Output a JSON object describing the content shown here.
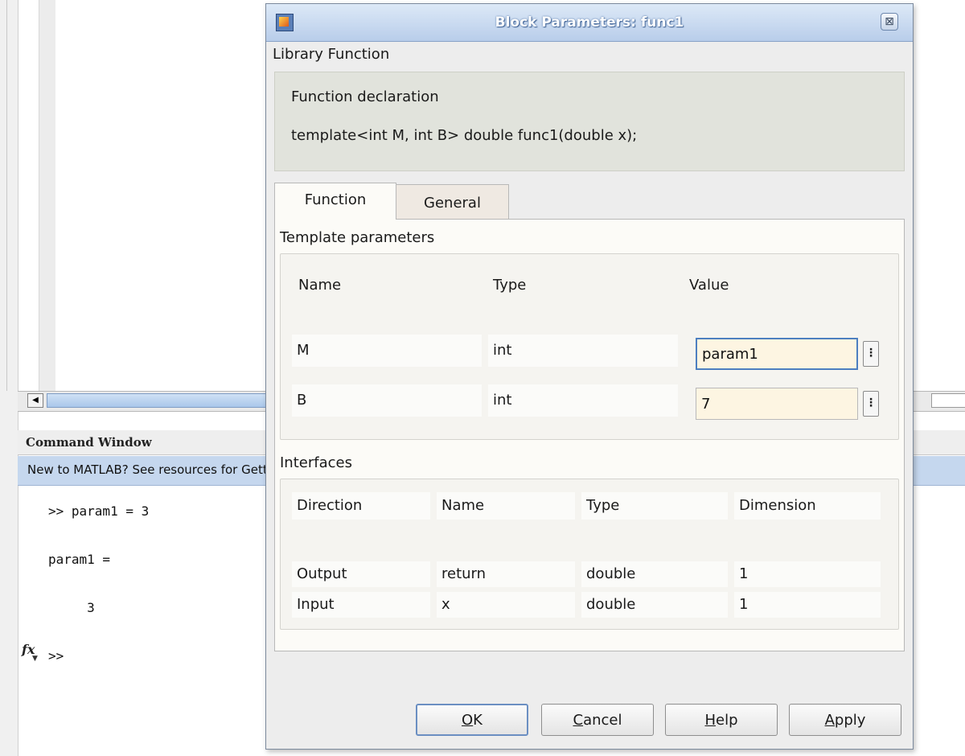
{
  "matlab": {
    "command_window_title": "Command Window",
    "info_bar_text": "New to MATLAB? See resources for Getting Started.",
    "command_lines": [
      ">> param1 = 3",
      "param1 =",
      "     3",
      ">>"
    ],
    "fx_label": "fx"
  },
  "dialog": {
    "title": "Block Parameters: func1",
    "close_glyph": "⊠",
    "library_label": "Library Function",
    "declaration": {
      "title": "Function declaration",
      "text": "template<int M, int B> double func1(double x);"
    },
    "tabs": [
      {
        "label": "Function",
        "active": true
      },
      {
        "label": "General",
        "active": false
      }
    ],
    "template_parameters": {
      "label": "Template parameters",
      "headers": [
        "Name",
        "Type",
        "Value"
      ],
      "rows": [
        {
          "name": "M",
          "type": "int",
          "value": "param1"
        },
        {
          "name": "B",
          "type": "int",
          "value": "7"
        }
      ],
      "more_glyph": "⋮"
    },
    "interfaces": {
      "label": "Interfaces",
      "headers": [
        "Direction",
        "Name",
        "Type",
        "Dimension"
      ],
      "rows": [
        {
          "direction": "Output",
          "name": "return",
          "type": "double",
          "dimension": "1"
        },
        {
          "direction": "Input",
          "name": "x",
          "type": "double",
          "dimension": "1"
        }
      ]
    },
    "buttons": {
      "ok": {
        "mnemonic": "O",
        "rest": "K"
      },
      "cancel": {
        "mnemonic": "C",
        "rest": "ancel"
      },
      "help": {
        "mnemonic": "H",
        "rest": "elp"
      },
      "apply": {
        "mnemonic": "A",
        "rest": "pply"
      }
    }
  },
  "colors": {
    "titlebar": "#b8cdea",
    "accent_focus": "#4d7fc0",
    "input_bg": "#fdf5e2",
    "info_bar": "#c5d7ee"
  }
}
